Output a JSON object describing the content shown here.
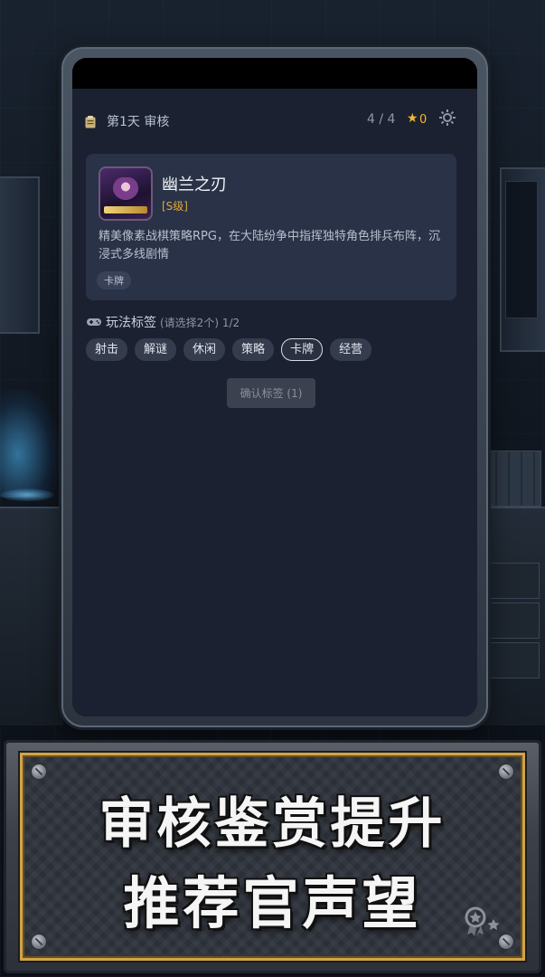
{
  "header": {
    "day_label": "第1天 审核",
    "progress": "4 / 4",
    "star_count": "0"
  },
  "game": {
    "title": "幽兰之刃",
    "grade": "[S级]",
    "description": "精美像素战棋策略RPG，在大陆纷争中指挥独特角色排兵布阵，沉浸式多线剧情",
    "tag": "卡牌"
  },
  "tags_section": {
    "title": "玩法标签",
    "hint": "(请选择2个) 1/2",
    "options": [
      "射击",
      "解谜",
      "休闲",
      "策略",
      "卡牌",
      "经营"
    ],
    "selected": "卡牌"
  },
  "confirm_button": "确认标签 (1)",
  "banner": {
    "line1": "审核鉴赏提升",
    "line2": "推荐官声望"
  },
  "colors": {
    "accent_gold": "#d1a447",
    "star": "#f3b731",
    "screen_bg": "#1b2130"
  }
}
